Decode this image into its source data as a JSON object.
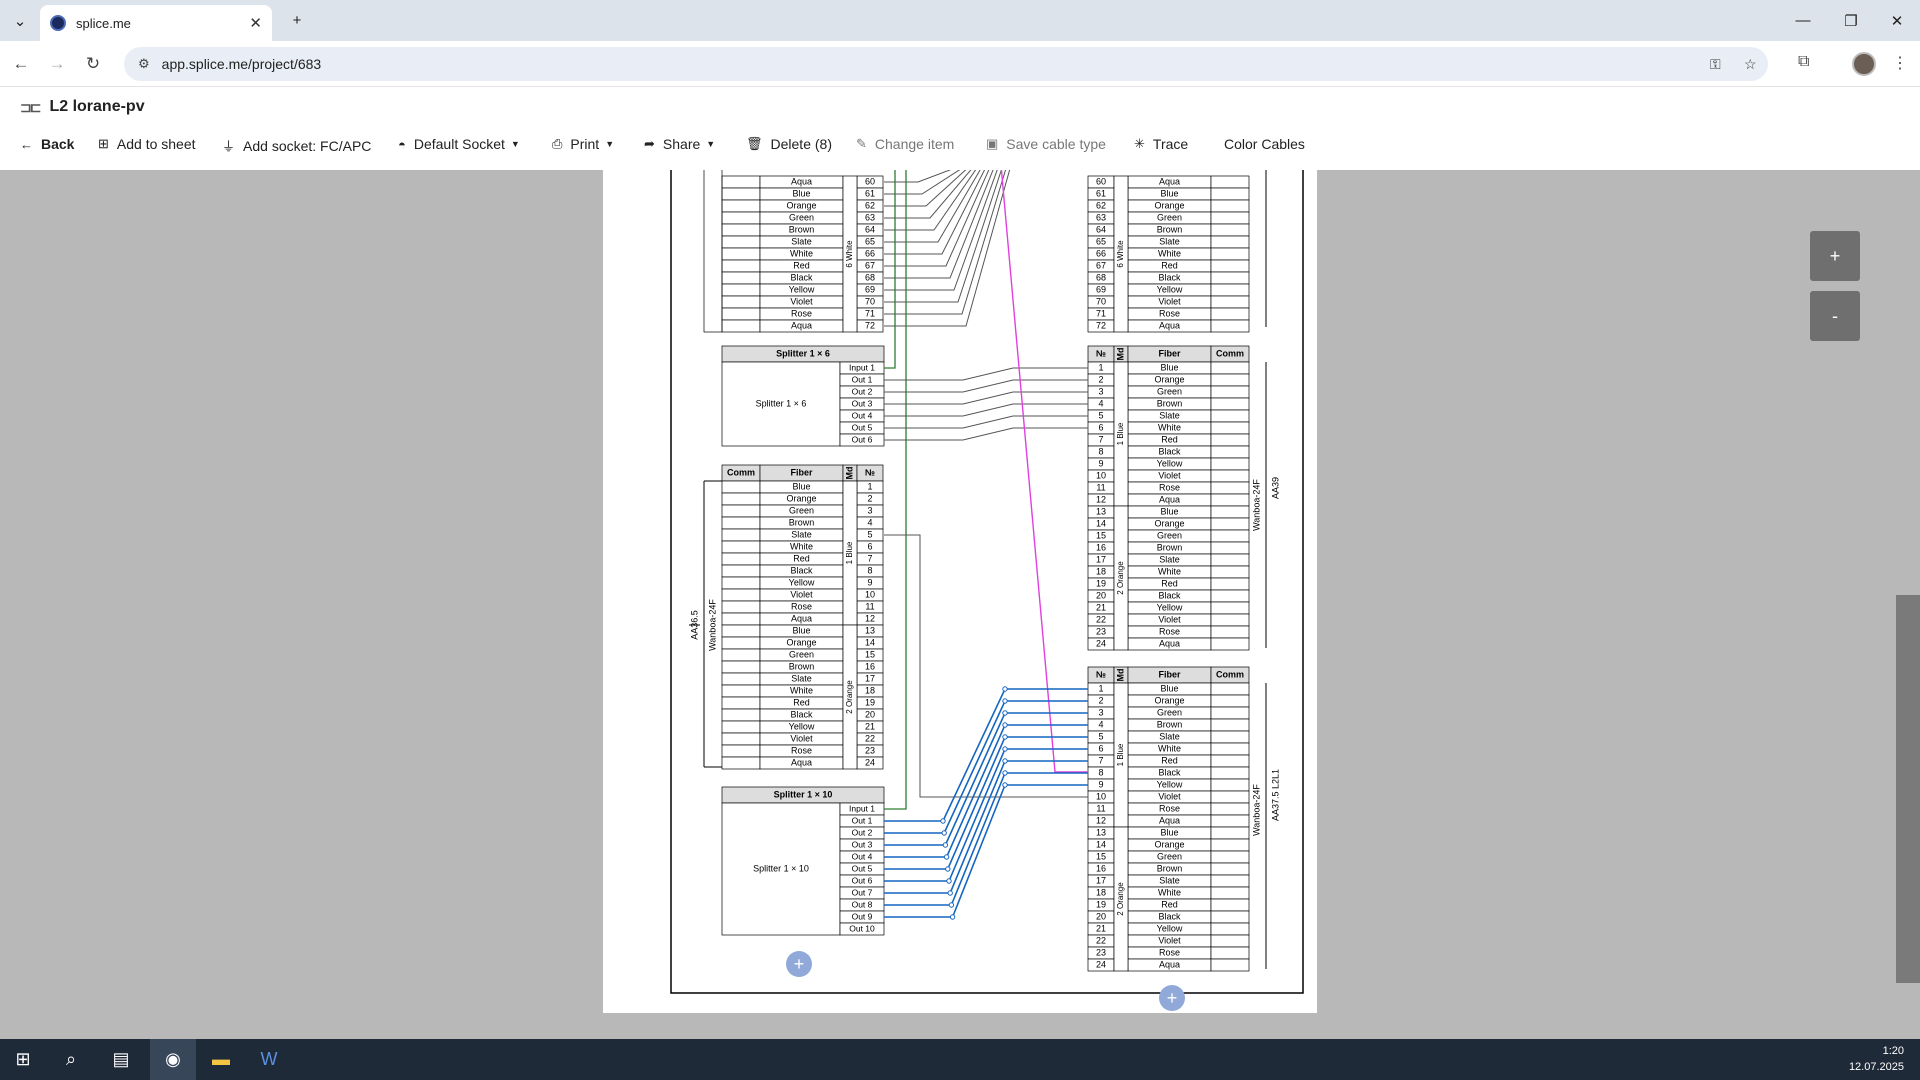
{
  "browser": {
    "tab_title": "splice.me",
    "url": "app.splice.me/project/683"
  },
  "app": {
    "title": "L2 lorane-pv"
  },
  "toolbar": {
    "back": "Back",
    "add_to_sheet": "Add to sheet",
    "add_socket": "Add socket: FC/APC",
    "default_socket": "Default Socket",
    "print": "Print",
    "share": "Share",
    "delete": "Delete (8)",
    "change_item": "Change item",
    "save_cable_type": "Save cable type",
    "trace": "Trace",
    "color_cables": "Color Cables"
  },
  "zoom": {
    "plus": "+",
    "minus": "-"
  },
  "colors": [
    "Blue",
    "Orange",
    "Green",
    "Brown",
    "Slate",
    "White",
    "Red",
    "Black",
    "Yellow",
    "Violet",
    "Rose",
    "Aqua"
  ],
  "diagram": {
    "headers": {
      "no": "№",
      "md": "Md",
      "fiber": "Fiber",
      "comm": "Comm"
    },
    "top_left": {
      "module": "6 White",
      "numbers": [
        60,
        61,
        62,
        63,
        64,
        65,
        66,
        67,
        68,
        69,
        70,
        71,
        72
      ],
      "fibers": [
        "Aqua",
        "Blue",
        "Orange",
        "Green",
        "Brown",
        "Slate",
        "White",
        "Red",
        "Black",
        "Yellow",
        "Violet",
        "Rose",
        "Aqua"
      ]
    },
    "top_right": {
      "module": "6 White",
      "numbers": [
        60,
        61,
        62,
        63,
        64,
        65,
        66,
        67,
        68,
        69,
        70,
        71,
        72
      ],
      "fibers": [
        "Aqua",
        "Blue",
        "Orange",
        "Green",
        "Brown",
        "Slate",
        "White",
        "Red",
        "Black",
        "Yellow",
        "Violet",
        "Rose",
        "Aqua"
      ]
    },
    "splitter6": {
      "title": "Splitter 1 × 6",
      "name": "Splitter 1 × 6",
      "ports": [
        "Input 1",
        "Out 1",
        "Out 2",
        "Out 3",
        "Out 4",
        "Out 5",
        "Out 6"
      ]
    },
    "splitter10": {
      "title": "Splitter 1 × 10",
      "name": "Splitter 1 × 10",
      "ports": [
        "Input 1",
        "Out 1",
        "Out 2",
        "Out 3",
        "Out 4",
        "Out 5",
        "Out 6",
        "Out 7",
        "Out 8",
        "Out 9",
        "Out 10"
      ]
    },
    "cable_left": {
      "name": "AA36.5",
      "type": "Wanboa-24F",
      "modules": [
        "1 Blue",
        "2 Orange"
      ]
    },
    "cable_r1": {
      "name": "AA39",
      "type": "Wanboa-24F",
      "modules": [
        "1 Blue",
        "2 Orange"
      ]
    },
    "cable_r2": {
      "name": "AA37.5 L2L1",
      "type": "Wanboa-24F",
      "modules": [
        "1 Blue",
        "2 Orange"
      ]
    }
  },
  "taskbar": {
    "time": "1:20",
    "date": "12.07.2025"
  }
}
